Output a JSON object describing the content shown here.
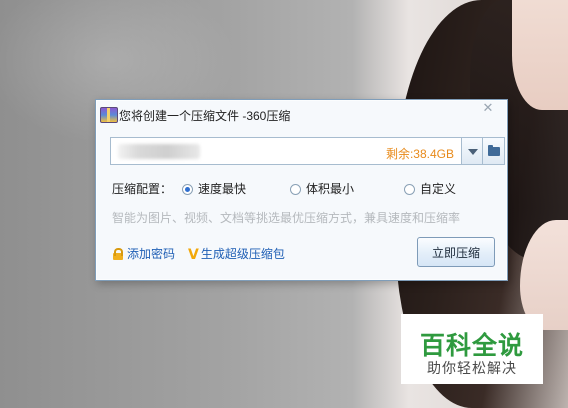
{
  "dialog": {
    "title": "您将创建一个压缩文件 -360压缩",
    "close_glyph": "✕",
    "free_space": "剩余:38.4GB",
    "config_label": "压缩配置：",
    "options": [
      {
        "label": "速度最快",
        "selected": true
      },
      {
        "label": "体积最小",
        "selected": false
      },
      {
        "label": "自定义",
        "selected": false
      }
    ],
    "hint": "智能为图片、视频、文档等挑选最优压缩方式，兼具速度和压缩率",
    "add_password": "添加密码",
    "super_pack": "生成超级压缩包",
    "compress_button": "立即压缩"
  },
  "watermark": {
    "title": "百科全说",
    "subtitle": "助你轻松解决"
  },
  "colors": {
    "accent": "#2f6fd0",
    "free_space": "#e88a1a",
    "link": "#1f5fb5",
    "watermark_green": "#2f9a3f"
  },
  "icons": [
    "app-icon",
    "close-icon",
    "chevron-down-icon",
    "folder-icon",
    "lock-icon",
    "v-icon"
  ]
}
